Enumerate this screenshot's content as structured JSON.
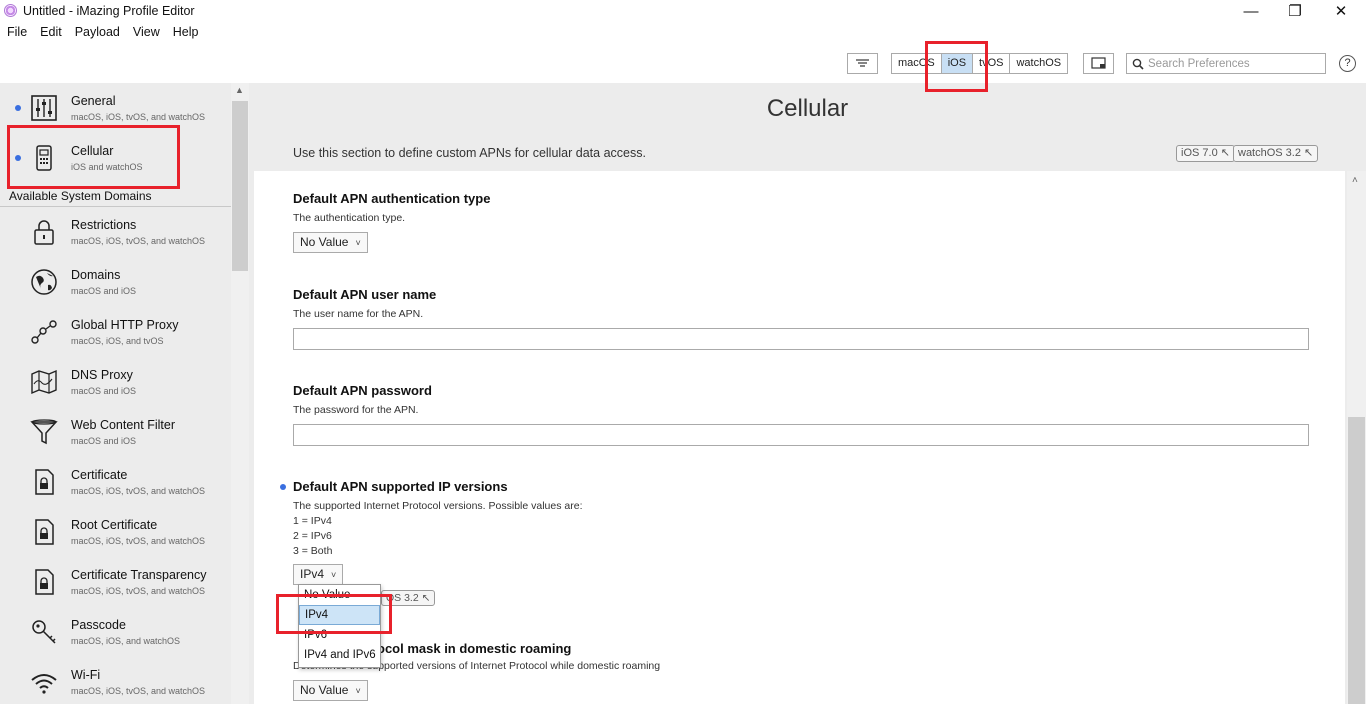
{
  "window": {
    "title": "Untitled - iMazing Profile Editor",
    "minimize": "—",
    "maximize": "❐",
    "close": "✕"
  },
  "menu": [
    "File",
    "Edit",
    "Payload",
    "View",
    "Help"
  ],
  "toolbar": {
    "platforms": [
      "macOS",
      "iOS",
      "tvOS",
      "watchOS"
    ],
    "active_platform": "iOS",
    "search_placeholder": "Search Preferences",
    "help": "?"
  },
  "sidebar": {
    "configured": [
      {
        "name": "General",
        "platforms": "macOS, iOS, tvOS, and watchOS",
        "icon": "sliders-icon"
      },
      {
        "name": "Cellular",
        "platforms": "iOS and watchOS",
        "icon": "phone-icon"
      }
    ],
    "domains_header": "Available System Domains",
    "domains": [
      {
        "name": "Restrictions",
        "platforms": "macOS, iOS, tvOS, and watchOS",
        "icon": "lock-icon"
      },
      {
        "name": "Domains",
        "platforms": "macOS and iOS",
        "icon": "globe-icon"
      },
      {
        "name": "Global HTTP Proxy",
        "platforms": "macOS, iOS, and tvOS",
        "icon": "proxy-nodes-icon"
      },
      {
        "name": "DNS Proxy",
        "platforms": "macOS and iOS",
        "icon": "map-icon"
      },
      {
        "name": "Web Content Filter",
        "platforms": "macOS and iOS",
        "icon": "funnel-icon"
      },
      {
        "name": "Certificate",
        "platforms": "macOS, iOS, tvOS, and watchOS",
        "icon": "certificate-icon"
      },
      {
        "name": "Root Certificate",
        "platforms": "macOS, iOS, tvOS, and watchOS",
        "icon": "root-certificate-icon"
      },
      {
        "name": "Certificate Transparency",
        "platforms": "macOS, iOS, tvOS, and watchOS",
        "icon": "certificate-transparency-icon"
      },
      {
        "name": "Passcode",
        "platforms": "macOS, iOS, and watchOS",
        "icon": "key-icon"
      },
      {
        "name": "Wi-Fi",
        "platforms": "macOS, iOS, tvOS, and watchOS",
        "icon": "wifi-icon"
      }
    ]
  },
  "main": {
    "title": "Cellular",
    "description": "Use this section to define custom APNs for cellular data access.",
    "badges": [
      "iOS 7.0",
      "watchOS 3.2"
    ],
    "fields": [
      {
        "title": "Default APN authentication type",
        "desc": "The authentication type.",
        "value": "No Value"
      },
      {
        "title": "Default APN user name",
        "desc": "The user name for the APN."
      },
      {
        "title": "Default APN password",
        "desc": "The password for the APN."
      },
      {
        "title": "Default APN supported IP versions",
        "desc_lines": [
          "The supported Internet Protocol versions. Possible values are:",
          "1 = IPv4",
          "2 = IPv6",
          "3 = Both"
        ],
        "value": "IPv4"
      },
      {
        "title": "Default APN protocol mask in domestic roaming",
        "title_visible": "ocol mask in domestic roaming",
        "desc": "Determines the supported versions of Internet Protocol while domestic roaming",
        "desc_visible": "Determines the supported versions of Internet Protocol while domestic roaming",
        "value": "No Value"
      }
    ],
    "dropdown": {
      "options": [
        "No Value",
        "IPv4",
        "IPv6",
        "IPv4 and IPv6"
      ],
      "selected": "IPv4"
    },
    "ghost_badge": "OS 3.2"
  },
  "colors": {
    "highlight": "#e8212b",
    "accent_dot": "#3a6fe0",
    "selected": "#cde4f7"
  }
}
